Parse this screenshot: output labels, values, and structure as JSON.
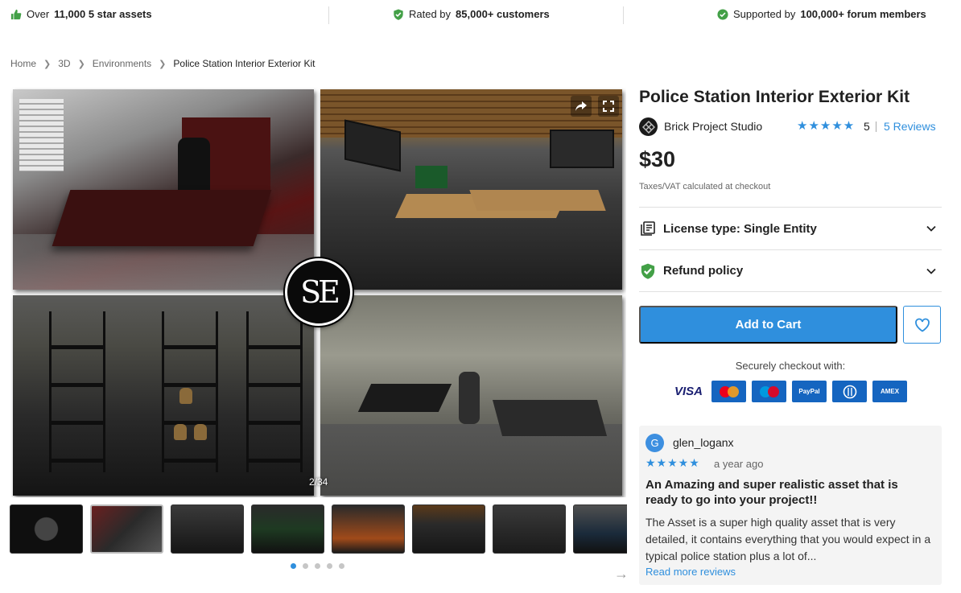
{
  "trust": {
    "item1_prefix": "Over",
    "item1_bold": "11,000 5 star assets",
    "item2_prefix": "Rated by",
    "item2_bold": "85,000+ customers",
    "item3_prefix": "Supported by",
    "item3_bold": "100,000+ forum members"
  },
  "breadcrumb": [
    "Home",
    "3D",
    "Environments",
    "Police Station Interior Exterior Kit"
  ],
  "gallery": {
    "counter": "2/34",
    "logo_text": "SE",
    "thumbnail_count": 8,
    "dots": 5,
    "active_dot": 0
  },
  "product": {
    "title": "Police Station Interior Exterior Kit",
    "publisher": "Brick Project Studio",
    "stars": "★★★★★",
    "rating": "5",
    "reviews_link": "5 Reviews",
    "price": "$30",
    "tax_note": "Taxes/VAT calculated at checkout",
    "license_label": "License type: Single Entity",
    "refund_label": "Refund policy",
    "add_to_cart": "Add to Cart",
    "secure_checkout": "Securely checkout with:"
  },
  "payment_methods": {
    "visa": "VISA",
    "paypal": "PayPal",
    "amex": "AMEX"
  },
  "review": {
    "avatar_letter": "G",
    "user": "glen_loganx",
    "stars": "★★★★★",
    "time": "a year ago",
    "title": "An Amazing and super realistic asset that is ready to go into your project!!",
    "body": "The Asset is a super high quality asset that is very detailed, it  contains everything that you would expect in a typical police station plus a lot of...",
    "read_more": "Read more reviews"
  },
  "colors": {
    "accent": "#2f8fdd",
    "check_green": "#43a047",
    "thumb_green": "#43a047"
  }
}
